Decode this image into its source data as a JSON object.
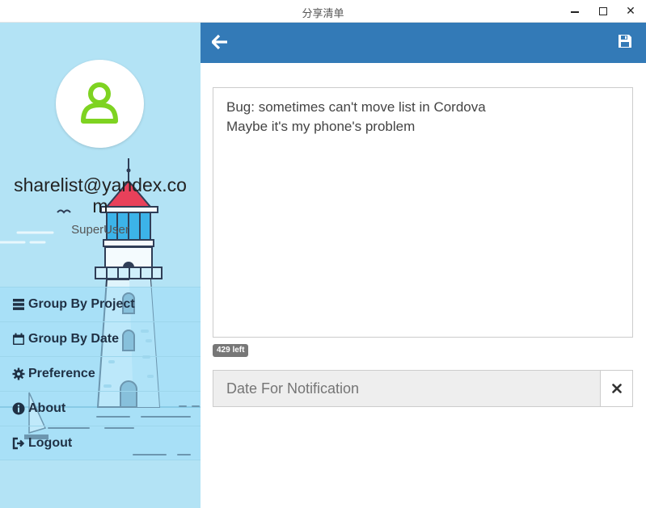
{
  "window": {
    "title": "分享清单",
    "controls": {
      "minimize": "minimize",
      "maximize": "maximize",
      "close": "close"
    }
  },
  "sidebar": {
    "email": "sharelist@yandex.com",
    "role": "SuperUser",
    "items": [
      {
        "label": "Group By Project",
        "icon": "tasks-icon"
      },
      {
        "label": "Group By Date",
        "icon": "calendar-icon"
      },
      {
        "label": "Preference",
        "icon": "gear-icon"
      },
      {
        "label": "About",
        "icon": "info-icon"
      },
      {
        "label": "Logout",
        "icon": "logout-icon"
      }
    ]
  },
  "toolbar": {
    "back_icon": "arrow-left-icon",
    "save_icon": "floppy-disk-icon"
  },
  "editor": {
    "lines": [
      "Bug: sometimes can't move list in Cordova",
      "Maybe it's my phone's problem"
    ],
    "remaining": "429 left",
    "date_placeholder": "Date For Notification",
    "clear_icon": "times-icon"
  },
  "colors": {
    "header": "#337ab7",
    "sidebar": "#b3e3f5",
    "avatar_icon": "#7ed321",
    "counter_badge": "#777777"
  }
}
